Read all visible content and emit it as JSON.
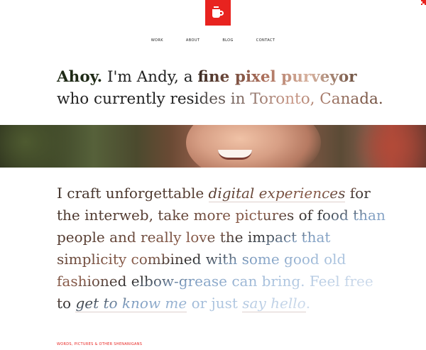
{
  "brand": {
    "logo_icon": "coffee-cup-icon",
    "accent": "#e8231f"
  },
  "nav": {
    "items": [
      {
        "label": "WORK"
      },
      {
        "label": "ABOUT"
      },
      {
        "label": "BLOG"
      },
      {
        "label": "CONTACT"
      }
    ]
  },
  "intro": {
    "ahoy": "Ahoy.",
    "pre": " I'm Andy, a ",
    "highlight": "fine pixel purveyor",
    "line2a": "who currently resi",
    "line2b": "des in Toronto, Canada."
  },
  "craft": {
    "t1": "I craft unforgettable ",
    "link1": "digital experiences",
    "t2": " for the interweb, take more pictures of food than people and really love the impact that simplicity combined with some good old fashioned elbow-grease can bring. Feel free to ",
    "link2": "get to know me",
    "t3": " or just ",
    "link3": "say hello",
    "t4": "."
  },
  "footer": {
    "tag": "WORDS, PICTURES & OTHER SHENANIGANS"
  }
}
